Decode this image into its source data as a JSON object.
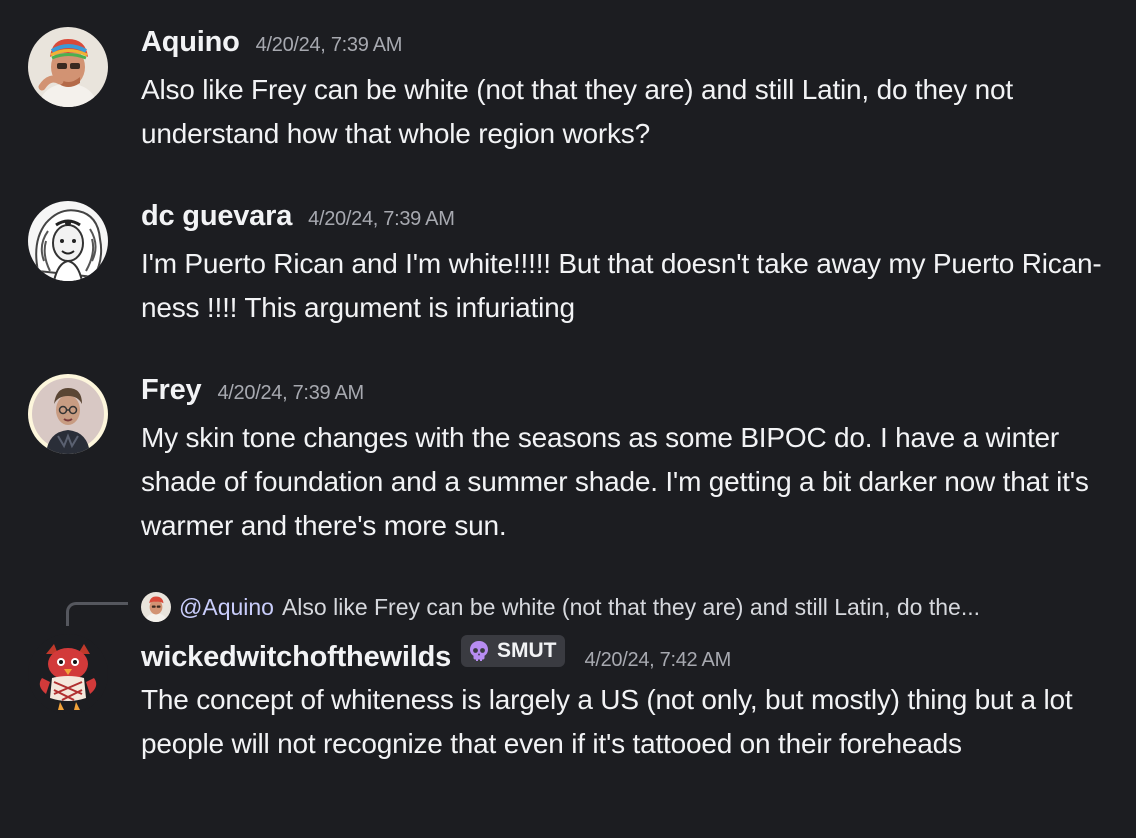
{
  "messages": [
    {
      "username": "Aquino",
      "timestamp": "4/20/24, 7:39 AM",
      "text": "Also like Frey can be white (not that they are) and still Latin, do they not understand how that whole region works?"
    },
    {
      "username": "dc guevara",
      "timestamp": "4/20/24, 7:39 AM",
      "text": "I'm Puerto Rican and I'm white!!!!! But that doesn't take away my Puerto Rican-ness !!!! This argument is infuriating"
    },
    {
      "username": "Frey",
      "timestamp": "4/20/24, 7:39 AM",
      "text": "My skin tone changes with the seasons as some BIPOC do. I have a winter shade of foundation and a summer shade. I'm getting a bit darker now that it's warmer and there's more sun."
    },
    {
      "username": "wickedwitchofthewilds",
      "timestamp": "4/20/24, 7:42 AM",
      "tag": {
        "icon": "skull-icon",
        "label": "SMUT"
      },
      "reply": {
        "mention": "@Aquino",
        "preview": "Also like Frey can be white (not that they are) and still Latin, do the..."
      },
      "text": "The concept of whiteness is largely a US (not only, but mostly) thing but a lot people will not recognize that even if it's tattooed on their foreheads"
    }
  ],
  "colors": {
    "background": "#1c1d21",
    "text": "#f2f3f5",
    "muted": "#a7a9b0",
    "mention": "#c9cdfb",
    "tag_bg": "#3a3b41",
    "skull": "#b78cf2"
  }
}
